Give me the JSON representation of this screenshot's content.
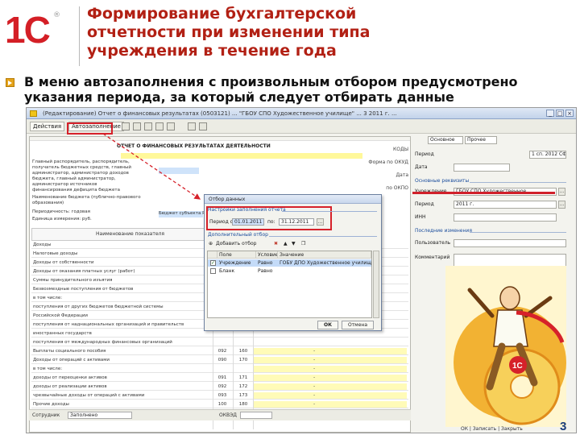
{
  "slide": {
    "logo": "1С",
    "title_lines": [
      "Формирование бухгалтерской",
      "отчетности при изменении типа",
      "учреждения в течение года"
    ],
    "bullet_lines": [
      "В меню автозаполнения с произвольным отбором предусмотрено",
      "указания периода, за который следует отбирать данные"
    ],
    "page_number": "3"
  },
  "window": {
    "title": "(Редактирование) Отчет о финансовых результатах (0503121) ... \"ГБОУ СПО Художественное училище\" ... 3 2011 г. ...",
    "toolbar": {
      "actions_label": "Действия",
      "autofill_label": "Автозаполнение"
    }
  },
  "report": {
    "heading": "ОТЧЕТ О ФИНАНСОВЫХ РЕЗУЛЬТАТАХ ДЕЯТЕЛЬНОСТИ",
    "codes": [
      "КОДЫ",
      "Форма по ОКУД",
      "Дата",
      "по ОКПО",
      "по ОКТМО"
    ],
    "left_texts": [
      "Главный распорядитель, распорядитель,",
      "получатель бюджетных средств, главный",
      "администратор, администратор доходов",
      "бюджета, главный администратор,",
      "администратор источников",
      "финансирования дефицита бюджета",
      "Наименование бюджета (публично-правового",
      "образования)",
      "Периодичность: годовая",
      "Единица измерения: руб."
    ],
    "budget_cell_text": "Бюджет субъекта РФ",
    "indicator_header": "Наименование показателя",
    "rows": [
      {
        "label": "Доходы",
        "c1": "",
        "c2": ""
      },
      {
        "label": "Налоговые доходы",
        "c1": "",
        "c2": ""
      },
      {
        "label": "Доходы от собственности",
        "c1": "",
        "c2": ""
      },
      {
        "label": "Доходы от оказания платных услуг (работ)",
        "c1": "",
        "c2": ""
      },
      {
        "label": "Суммы принудительного изъятия",
        "c1": "",
        "c2": ""
      },
      {
        "label": "Безвозмездные поступления от бюджетов",
        "c1": "",
        "c2": ""
      },
      {
        "label": "в том числе:",
        "c1": "",
        "c2": ""
      },
      {
        "label": "поступления от других бюджетов бюджетной системы",
        "c1": "",
        "c2": ""
      },
      {
        "label": "Российской Федерации",
        "c1": "",
        "c2": ""
      },
      {
        "label": "поступления от наднациональных организаций и правительств",
        "c1": "",
        "c2": ""
      },
      {
        "label": "иностранных государств",
        "c1": "",
        "c2": ""
      },
      {
        "label": "поступления от международных финансовых организаций",
        "c1": "",
        "c2": ""
      },
      {
        "label": "Выплаты социального пособия",
        "c1": "092",
        "c2": "160"
      },
      {
        "label": "Доходы от операций с активами",
        "c1": "090",
        "c2": "170"
      },
      {
        "label": "в том числе:",
        "c1": "",
        "c2": ""
      },
      {
        "label": "доходы от переоценки активов",
        "c1": "091",
        "c2": "171"
      },
      {
        "label": "доходы от реализации активов",
        "c1": "092",
        "c2": "172"
      },
      {
        "label": "чрезвычайные доходы от операций с активами",
        "c1": "093",
        "c2": "173"
      },
      {
        "label": "Прочие доходы",
        "c1": "100",
        "c2": "180"
      }
    ],
    "dash_mark": "-",
    "footer": {
      "label": "Сотрудник",
      "value": "Заполнено",
      "code_label": "ОКВЭД",
      "code_value": ""
    }
  },
  "panel": {
    "tab_label": "Основное",
    "tab2_label": "Прочее",
    "period_label": "Период",
    "period_value": "1 сп. 2012 СФ",
    "date_label": "Дата",
    "date_value": "",
    "section_main": "Основные реквизиты",
    "org_label": "Учреждение",
    "org_value": "ГБОУ СПО Художественное...",
    "period_field_label": "Период",
    "period_field_value": "2011 г.",
    "inn_label": "ИНН",
    "inn_value": "",
    "section_other": "Последние изменения",
    "modified_label": "Пользователь",
    "modified_value": "",
    "comment_label": "Комментарий",
    "comment_value": ""
  },
  "dialog": {
    "title": "Отбор данных",
    "settings_section": "Настройки заполнения отчета",
    "period_label": "Период с:",
    "period_from": "01.01.2011",
    "period_to_label": "по:",
    "period_to": "31.12.2011",
    "extra_section": "Дополнительный отбор",
    "add_label": "Добавить отбор",
    "col_field": "Поле",
    "col_condition": "Условие",
    "col_value": "Значение",
    "rows": [
      {
        "field": "Учреждение",
        "condition": "Равно",
        "value": "ГОБУ ДПО Художественное училище",
        "checked": true
      },
      {
        "field": "Бланк",
        "condition": "Равно",
        "value": "",
        "checked": false
      }
    ],
    "ok_label": "ОК",
    "cancel_label": "Отмена"
  },
  "bottom_bar": "ОК | Записать | Закрыть"
}
